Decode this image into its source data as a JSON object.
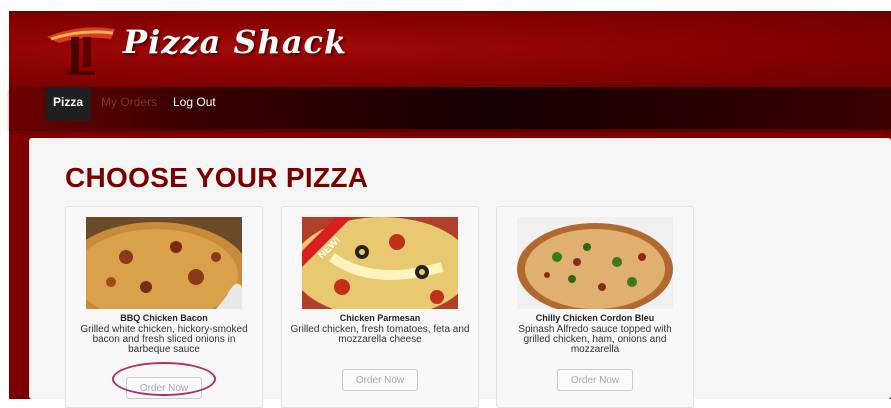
{
  "header": {
    "brand_name": "Pizza Shack",
    "logo_icon": "pizza-logo-icon"
  },
  "nav": {
    "items": [
      {
        "label": "Pizza",
        "active": true
      },
      {
        "label": "My Orders",
        "active": false
      },
      {
        "label": "Log Out",
        "active": false
      }
    ]
  },
  "main": {
    "heading": "CHOOSE YOUR PIZZA",
    "cards": [
      {
        "title": "BBQ Chicken Bacon",
        "description": "Grilled white chicken, hickory-smoked bacon and fresh sliced onions in barbeque sauce",
        "button": "Order Now",
        "highlighted": true
      },
      {
        "title": "Chicken Parmesan",
        "description": "Grilled chicken, fresh tomatoes, feta and mozzarella cheese",
        "button": "Order Now",
        "badge": "NEW!"
      },
      {
        "title": "Chilly Chicken Cordon Bleu",
        "description": "Spinash Alfredo sauce topped with grilled chicken, ham, onions and mozzarella",
        "button": "Order Now"
      }
    ]
  },
  "colors": {
    "brand_red": "#7d0000",
    "heading": "#7a0000",
    "highlight_ring": "#b0306a"
  }
}
